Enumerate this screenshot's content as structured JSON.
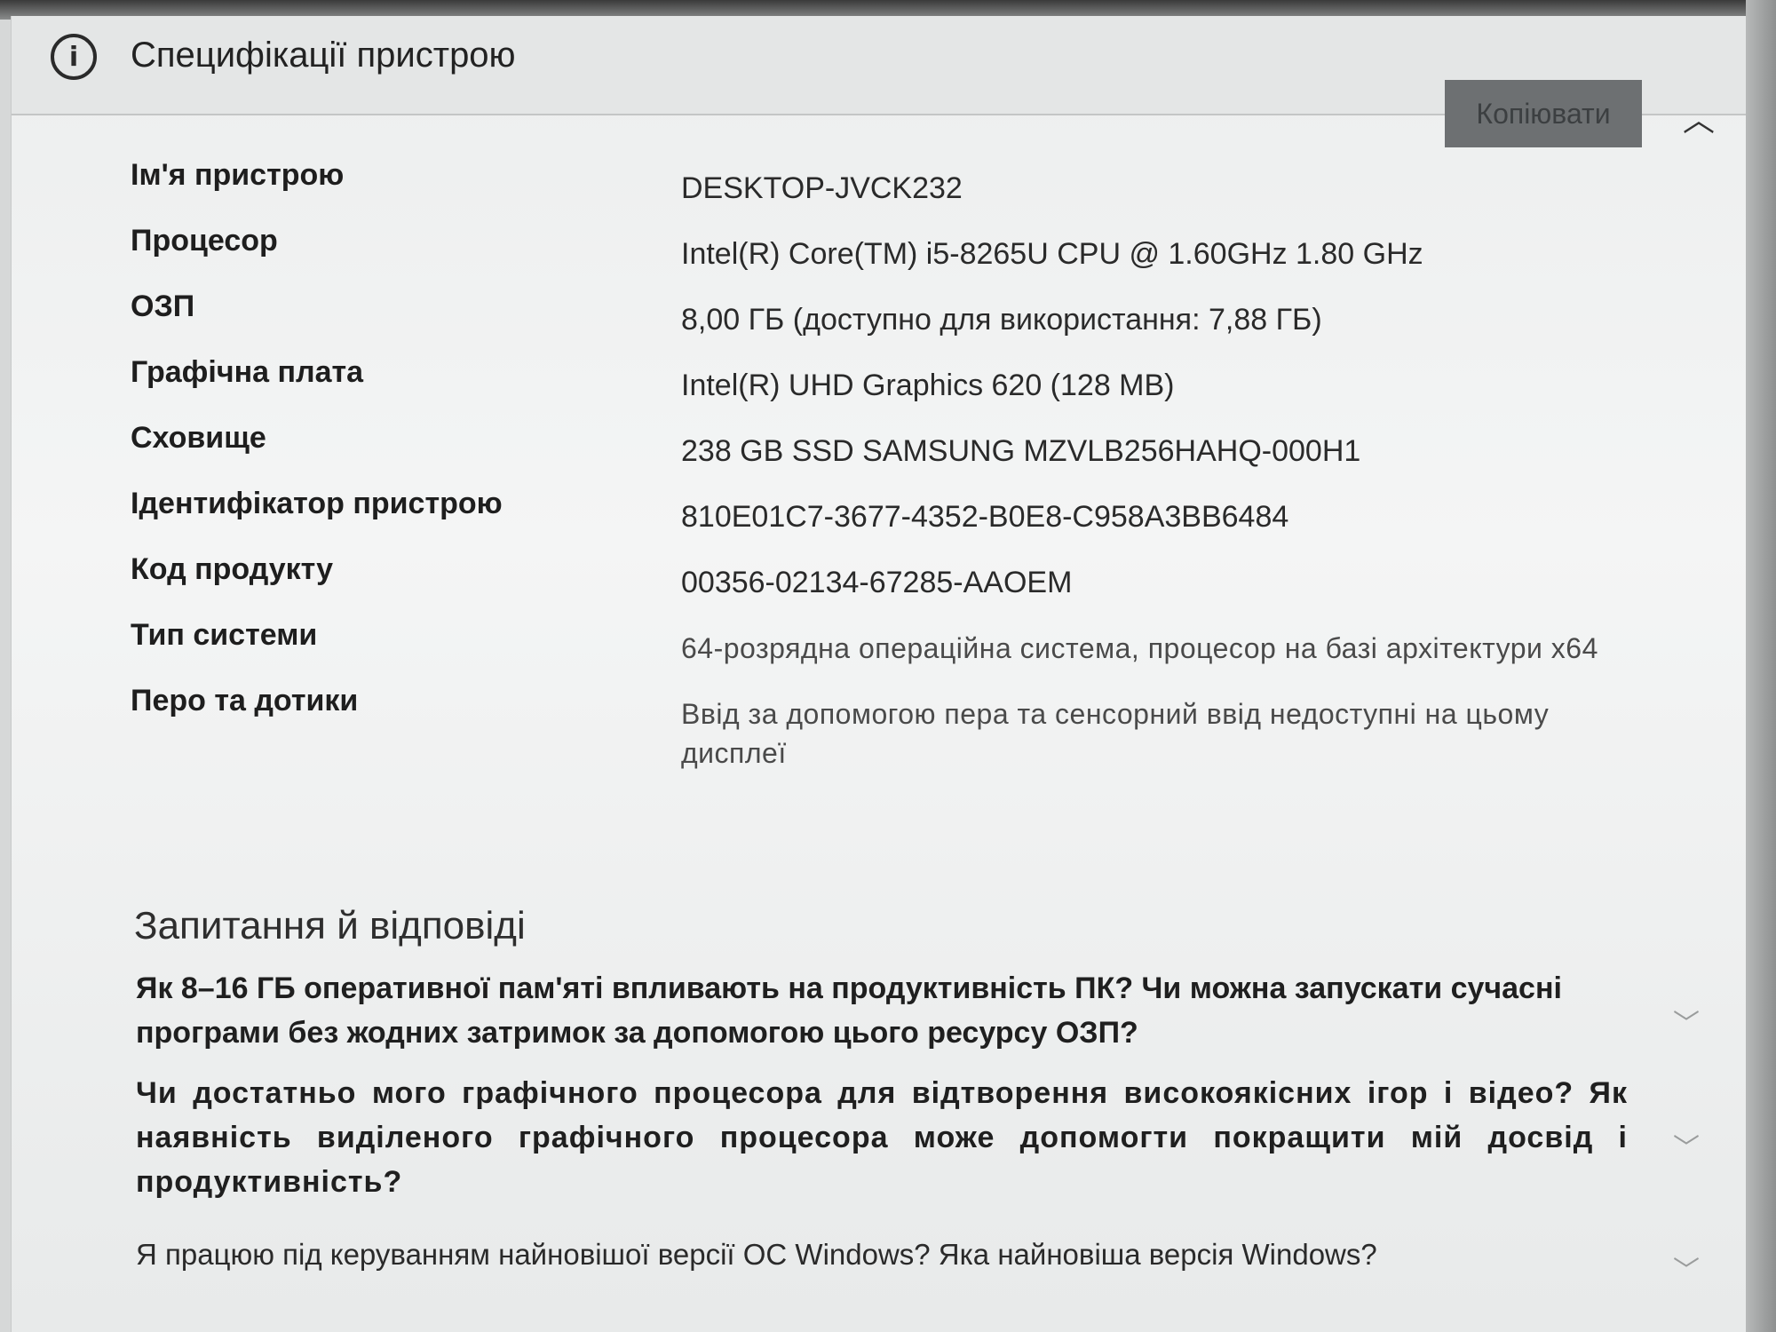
{
  "section": {
    "title": "Специфікації пристрою",
    "icon": "info-icon",
    "copy_label": "Копіювати",
    "collapse_icon": "chevron-up-icon"
  },
  "specs": [
    {
      "label": "Ім'я пристрою",
      "value": "DESKTOP-JVCK232"
    },
    {
      "label": "Процесор",
      "value": "Intel(R) Core(TM) i5-8265U CPU @ 1.60GHz   1.80 GHz"
    },
    {
      "label": "ОЗП",
      "value": "8,00 ГБ (доступно для використання: 7,88 ГБ)"
    },
    {
      "label": "Графічна плата",
      "value": "Intel(R) UHD Graphics 620 (128 MB)"
    },
    {
      "label": "Сховище",
      "value": "238 GB SSD SAMSUNG MZVLB256HAHQ-000H1"
    },
    {
      "label": "Ідентифікатор пристрою",
      "value": "810E01C7-3677-4352-B0E8-C958A3BB6484"
    },
    {
      "label": "Код продукту",
      "value": "00356-02134-67285-AAOEM"
    },
    {
      "label": "Тип системи",
      "value": "64-розрядна операційна система, процесор на базі архітектури x64"
    },
    {
      "label": "Перо та дотики",
      "value": "Ввід за допомогою пера та сенсорний ввід недоступні на цьому дисплеї"
    }
  ],
  "faq": {
    "title": "Запитання й відповіді",
    "items": [
      "Як 8–16 ГБ оперативної пам'яті впливають на продуктивність ПК? Чи можна запускати сучасні програми без жодних затримок за допомогою цього ресурсу ОЗП?",
      "Чи достатньо мого графічного процесора для відтворення високоякісних ігор і відео? Як наявність виділеного графічного процесора може допомогти покращити мій досвід і продуктивність?",
      "Я працюю під керуванням найновішої версії ОС Windows? Яка найновіша версія Windows?"
    ],
    "expand_icon": "chevron-down-icon"
  }
}
